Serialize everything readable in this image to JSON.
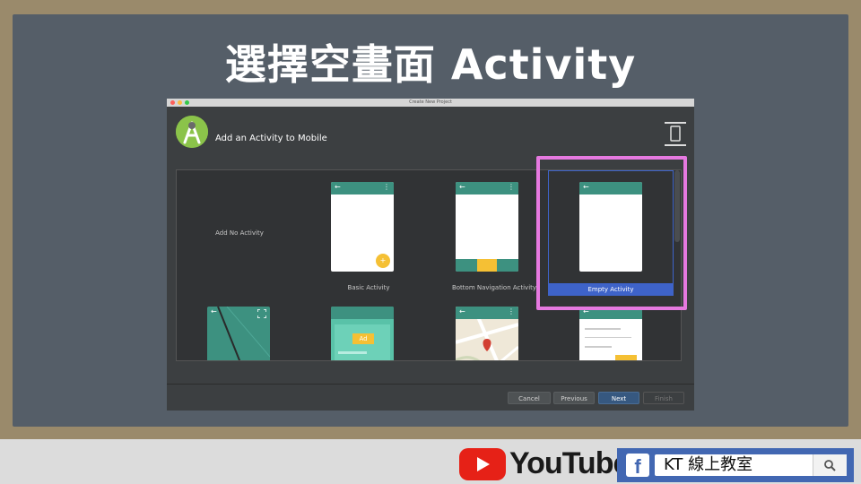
{
  "slide": {
    "title": "選擇空畫面 Activity"
  },
  "window": {
    "title": "Create New Project",
    "header_title": "Add an Activity to Mobile"
  },
  "templates": [
    {
      "label": "Add No Activity",
      "selected": false
    },
    {
      "label": "Basic Activity",
      "selected": false
    },
    {
      "label": "Bottom Navigation Activity",
      "selected": false
    },
    {
      "label": "Empty Activity",
      "selected": true
    }
  ],
  "templates_row2": {
    "ad_label": "Ad"
  },
  "phone": {
    "back_glyph": "←",
    "menu_glyph": "⋮",
    "fab_glyph": "+"
  },
  "buttons": {
    "cancel": "Cancel",
    "previous": "Previous",
    "next": "Next",
    "finish": "Finish"
  },
  "branding": {
    "youtube_text": "YouTube",
    "facebook_glyph": "f",
    "facebook_search_text": "KT 線上教室"
  },
  "colors": {
    "accent": "#3d9180",
    "fab": "#f5c034",
    "selected": "#3e63c9",
    "highlight": "#e679e0",
    "youtube": "#e62117",
    "facebook": "#4267b2"
  }
}
